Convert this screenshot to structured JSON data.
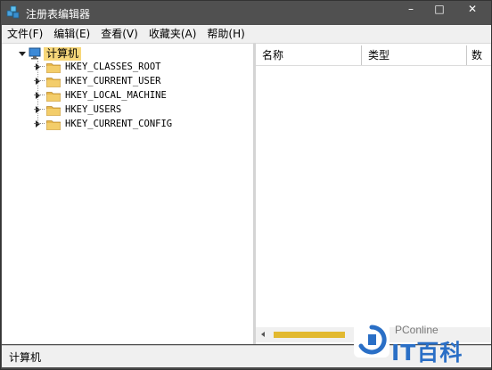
{
  "window": {
    "title": "注册表编辑器",
    "controls": {
      "minimize": "–",
      "maximize": "□",
      "close": "✕"
    }
  },
  "menu": [
    {
      "label": "文件(F)"
    },
    {
      "label": "编辑(E)"
    },
    {
      "label": "查看(V)"
    },
    {
      "label": "收藏夹(A)"
    },
    {
      "label": "帮助(H)"
    }
  ],
  "tree": {
    "root": {
      "label": "计算机",
      "expanded": true
    },
    "keys": [
      {
        "label": "HKEY_CLASSES_ROOT"
      },
      {
        "label": "HKEY_CURRENT_USER"
      },
      {
        "label": "HKEY_LOCAL_MACHINE"
      },
      {
        "label": "HKEY_USERS"
      },
      {
        "label": "HKEY_CURRENT_CONFIG"
      }
    ]
  },
  "list": {
    "columns": [
      {
        "label": "名称"
      },
      {
        "label": "类型"
      },
      {
        "label": "数"
      }
    ]
  },
  "status": {
    "path": "计算机"
  },
  "watermark": {
    "brand": "PConline",
    "name": "IT百科"
  },
  "colors": {
    "titlebar": "#505050",
    "selection_highlight": "#f7d77a",
    "folder": "#e8b84a",
    "watermark_blue": "#2a6fc6"
  }
}
